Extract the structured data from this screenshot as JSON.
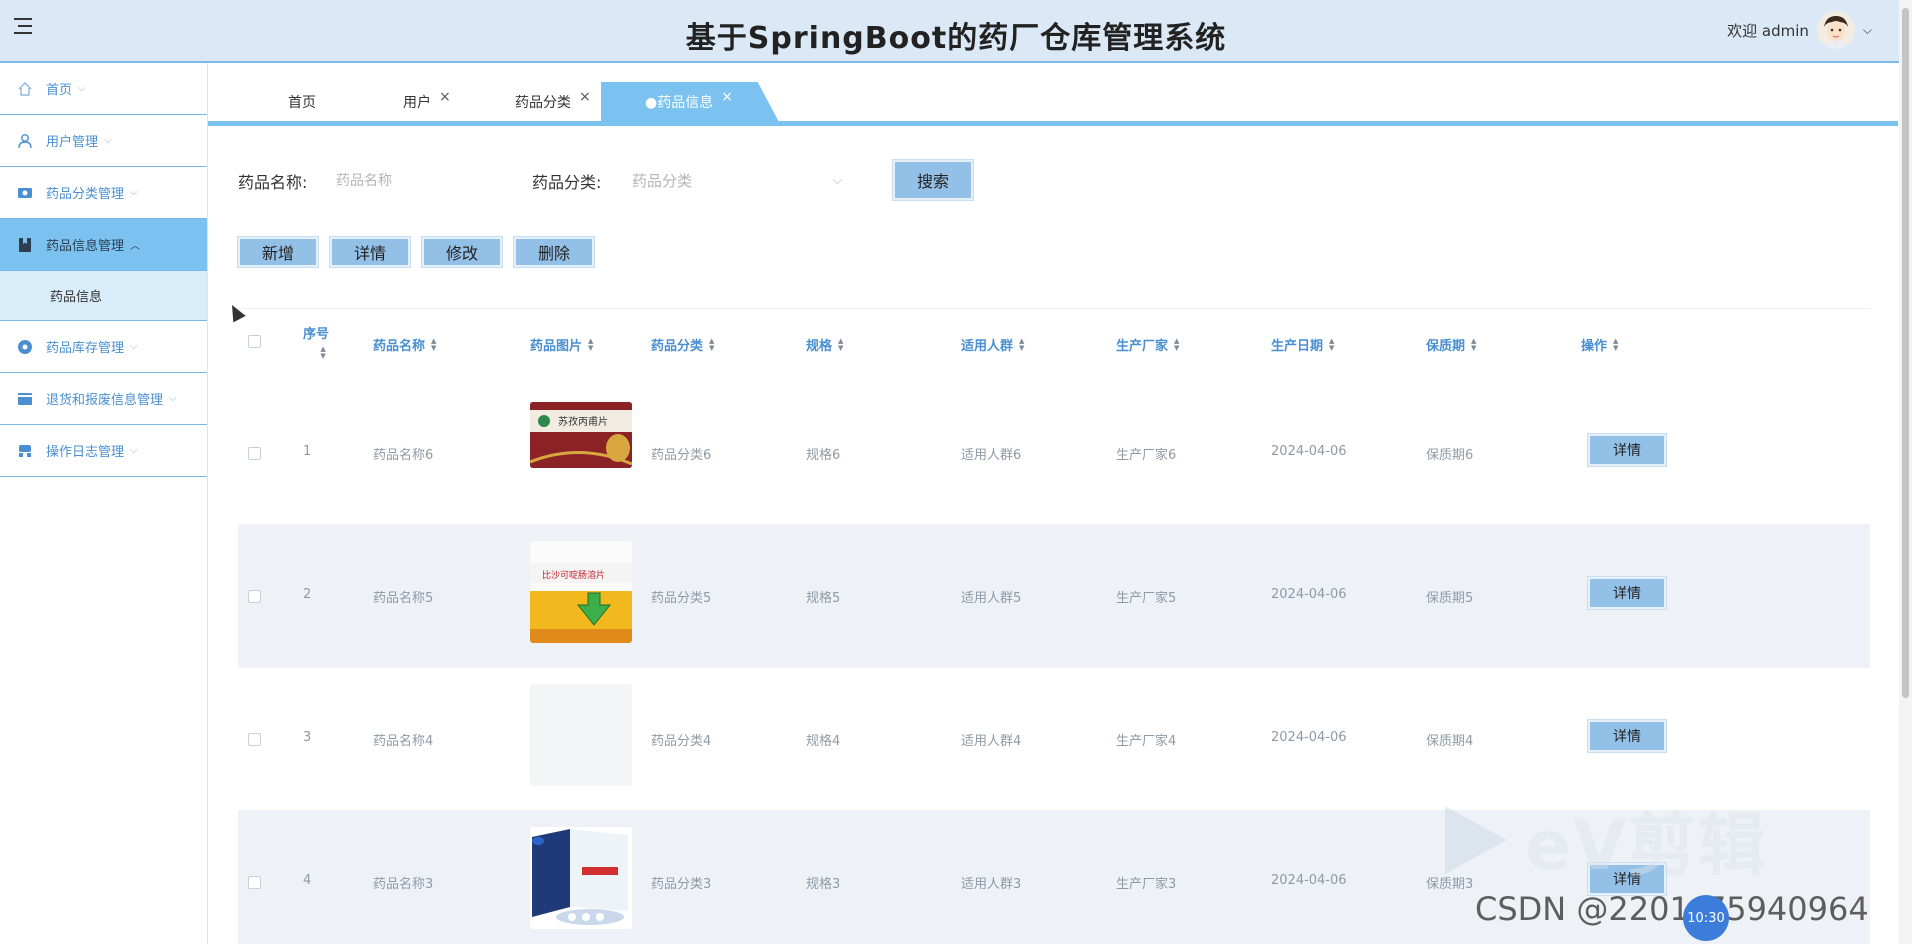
{
  "header": {
    "title": "基于SpringBoot的药厂仓库管理系统",
    "welcome": "欢迎 admin",
    "caret": "⌵"
  },
  "sidebar": {
    "items": [
      {
        "label": "首页",
        "icon": "home-icon"
      },
      {
        "label": "用户管理",
        "icon": "user-icon"
      },
      {
        "label": "药品分类管理",
        "icon": "category-icon"
      },
      {
        "label": "药品信息管理",
        "icon": "bookmark-icon",
        "active": true,
        "sub": [
          "药品信息"
        ]
      },
      {
        "label": "药品库存管理",
        "icon": "inventory-icon"
      },
      {
        "label": "退货和报废信息管理",
        "icon": "card-icon"
      },
      {
        "label": "操作日志管理",
        "icon": "log-icon"
      }
    ]
  },
  "tabs": [
    {
      "label": "首页",
      "closable": false
    },
    {
      "label": "用户",
      "closable": true
    },
    {
      "label": "药品分类",
      "closable": true
    },
    {
      "label": "●药品信息",
      "closable": true,
      "active": true
    }
  ],
  "tab_close": "×",
  "search": {
    "name_label": "药品名称:",
    "name_placeholder": "药品名称",
    "category_label": "药品分类:",
    "category_placeholder": "药品分类",
    "search_button": "搜索"
  },
  "toolbar": {
    "add": "新增",
    "detail": "详情",
    "edit": "修改",
    "delete": "删除"
  },
  "table": {
    "columns": [
      "序号",
      "药品名称",
      "药品图片",
      "药品分类",
      "规格",
      "适用人群",
      "生产厂家",
      "生产日期",
      "保质期",
      "操作"
    ],
    "rows": [
      {
        "index": "1",
        "name": "药品名称6",
        "category": "药品分类6",
        "spec": "规格6",
        "crowd": "适用人群6",
        "maker": "生产厂家6",
        "date": "2024-04-06",
        "shelf": "保质期6",
        "action": "详情",
        "image": "red-box",
        "image_text": "苏孜丙甫片"
      },
      {
        "index": "2",
        "name": "药品名称5",
        "category": "药品分类5",
        "spec": "规格5",
        "crowd": "适用人群5",
        "maker": "生产厂家5",
        "date": "2024-04-06",
        "shelf": "保质期5",
        "action": "详情",
        "image": "yellow-box",
        "image_text": "比沙可啶肠溶片"
      },
      {
        "index": "3",
        "name": "药品名称4",
        "category": "药品分类4",
        "spec": "规格4",
        "crowd": "适用人群4",
        "maker": "生产厂家4",
        "date": "2024-04-06",
        "shelf": "保质期4",
        "action": "详情",
        "image": "empty"
      },
      {
        "index": "4",
        "name": "药品名称3",
        "category": "药品分类3",
        "spec": "规格3",
        "crowd": "适用人群3",
        "maker": "生产厂家3",
        "date": "2024-04-06",
        "shelf": "保质期3",
        "action": "详情",
        "image": "blue-box"
      }
    ]
  },
  "watermark": {
    "ev": "eV剪辑",
    "csdn": "CSDN @2201_75940964",
    "time": "10:30"
  },
  "colors": {
    "accent": "#7cc2f1",
    "header_bg": "#dbe8f5",
    "button": "#93c0e7",
    "link": "#4a8fd1"
  }
}
